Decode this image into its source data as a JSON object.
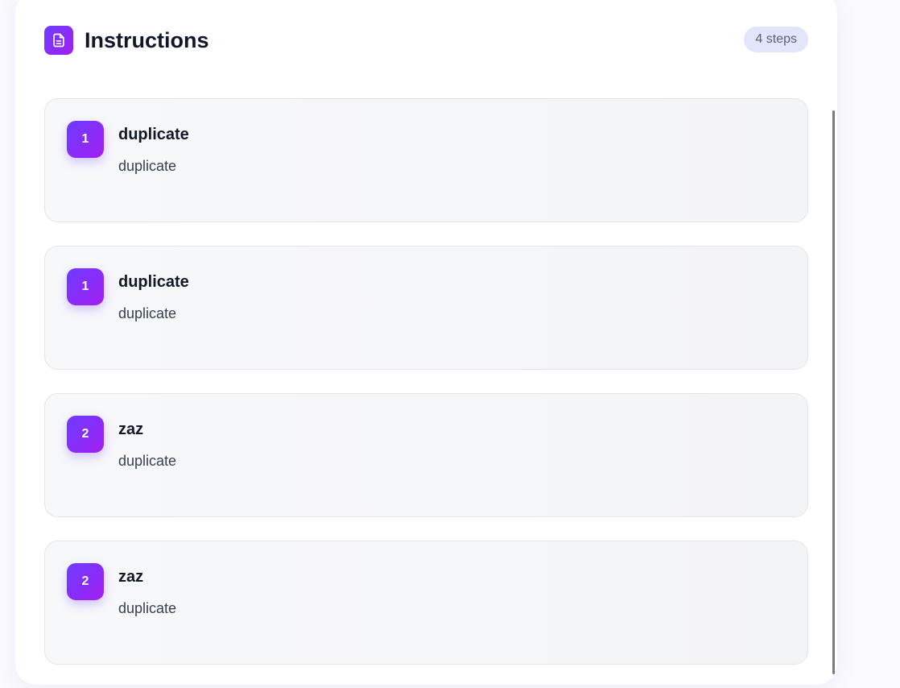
{
  "header": {
    "title": "Instructions",
    "icon": "document-icon",
    "count_label": "4 steps"
  },
  "steps": [
    {
      "number": "1",
      "title": "duplicate",
      "description": "duplicate"
    },
    {
      "number": "1",
      "title": "duplicate",
      "description": "duplicate"
    },
    {
      "number": "2",
      "title": "zaz",
      "description": "duplicate"
    },
    {
      "number": "2",
      "title": "zaz",
      "description": "duplicate"
    }
  ],
  "colors": {
    "accent_start": "#6d3cff",
    "accent_end": "#a020f0",
    "badge_bg": "#e3e6fb"
  }
}
